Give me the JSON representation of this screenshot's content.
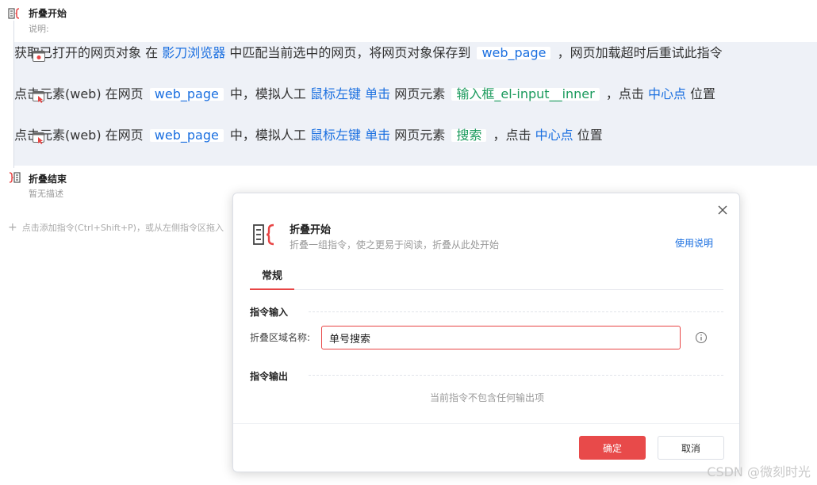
{
  "flow": {
    "fold_start": {
      "title": "折叠开始",
      "desc": "说明:"
    },
    "steps": [
      {
        "title": "获取已打开的网页对象",
        "desc_pre": "在",
        "browser": "影刀浏览器",
        "desc_mid": "中匹配当前选中的网页，将网页对象保存到",
        "var": "web_page",
        "desc_post": "，网页加载超时后重试此指令"
      },
      {
        "title": "点击元素(web)",
        "desc_pre": "在网页",
        "var": "web_page",
        "desc_a": "中，模拟人工",
        "mouse_key": "鼠标左键",
        "click_type": "单击",
        "desc_b": "网页元素",
        "element": "输入框_el-input__inner",
        "desc_c": "，点击",
        "point": "中心点",
        "desc_d": "位置"
      },
      {
        "title": "点击元素(web)",
        "desc_pre": "在网页",
        "var": "web_page",
        "desc_a": "中，模拟人工",
        "mouse_key": "鼠标左键",
        "click_type": "单击",
        "desc_b": "网页元素",
        "element": "搜索",
        "desc_c": "，点击",
        "point": "中心点",
        "desc_d": "位置"
      }
    ],
    "fold_end": {
      "title": "折叠结束",
      "desc": "暂无描述"
    },
    "add_hint": "点击添加指令(Ctrl+Shift+P)，或从左侧指令区拖入"
  },
  "dialog": {
    "title": "折叠开始",
    "subtitle": "折叠一组指令，使之更易于阅读，折叠从此处开始",
    "help_link": "使用说明",
    "tabs": [
      "常规"
    ],
    "input_section": "指令输入",
    "field_label": "折叠区域名称:",
    "field_value": "单号搜索",
    "output_section": "指令输出",
    "output_empty": "当前指令不包含任何输出项",
    "ok_label": "确定",
    "cancel_label": "取消"
  },
  "watermark": "CSDN @微刻时光",
  "colors": {
    "accent": "#e84a4a",
    "link": "#1a6fe0",
    "element_green": "#1a9a5c",
    "fold_bg": "#eef1f7"
  },
  "icons": [
    "fold-start-icon",
    "web-page-icon",
    "click-element-icon",
    "fold-end-icon",
    "close-icon",
    "info-icon",
    "plus-icon"
  ]
}
